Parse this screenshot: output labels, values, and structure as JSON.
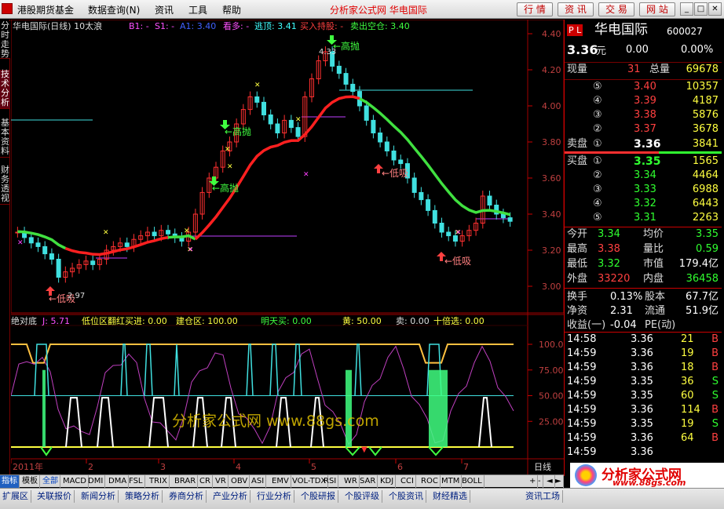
{
  "menu": {
    "items": [
      "港股期货基金",
      "数据查询(N)",
      "资讯",
      "工具",
      "帮助"
    ],
    "title": "分析家公式网  华电国际",
    "buttons": [
      "行 情",
      "资 讯",
      "交 易",
      "网 站"
    ]
  },
  "left_tabs": [
    "分时走势",
    "技术分析",
    "基本资料",
    "财务透视"
  ],
  "chart": {
    "header": "华电国际(日线) 10太浪",
    "header_items": [
      {
        "text": "B1: -",
        "color": "#ff50ff"
      },
      {
        "text": "S1: -",
        "color": "#ff50ff"
      },
      {
        "text": "A1: 3.40",
        "color": "#4060ff"
      },
      {
        "text": "看多: -",
        "color": "#ff50ff"
      },
      {
        "text": "逃顶: 3.41",
        "color": "#40ffff"
      },
      {
        "text": "买入持股: -",
        "color": "#ff4040"
      },
      {
        "text": "卖出空仓: 3.40",
        "color": "#40ff40"
      }
    ],
    "price_ticks": [
      "4.40",
      "4.20",
      "4.00",
      "3.80",
      "3.60",
      "3.40",
      "3.20",
      "3.00"
    ],
    "annotations": {
      "high_sell_1": "←高抛",
      "high_sell_2": "←高抛",
      "high_sell_3": "←高抛",
      "low_buy_1": "←低吸",
      "low_buy_2": "←低吸",
      "low_buy_3": "←低吸",
      "max_price": "4.33",
      "min_price": "2.97"
    },
    "indicator_header": [
      {
        "text": "绝对底",
        "color": "#ddd"
      },
      {
        "text": "J: 5.71",
        "color": "#ff50ff"
      },
      {
        "text": "低位区翻红买进: 0.00",
        "color": "#ffff40"
      },
      {
        "text": "建仓区: 100.00",
        "color": "#ffff40"
      },
      {
        "text": "明天买: 0.00",
        "color": "#40ff40"
      },
      {
        "text": "黄: 50.00",
        "color": "#ffff40"
      },
      {
        "text": "卖: 0.00",
        "color": "#ddd"
      },
      {
        "text": "十倍选: 0.00",
        "color": "#ffff40"
      }
    ],
    "ind_ticks": [
      "100.00",
      "75.00",
      "50.00",
      "25.00"
    ],
    "x_labels": [
      "2011年",
      "2",
      "3",
      "4",
      "5",
      "6",
      "7"
    ],
    "watermark": "分析家公式网 www.88gs.com",
    "period": "日线"
  },
  "quote": {
    "name": "华电国际",
    "code": "600027",
    "pl": "P L",
    "price": "3.36",
    "price_unit": "元",
    "change": "0.00",
    "change_pct": "0.00%",
    "volume_label": "现量",
    "volume": "31",
    "total_label": "总量",
    "total": "69678",
    "asks": [
      {
        "lv": "⑤",
        "p": "3.40",
        "v": "10357"
      },
      {
        "lv": "④",
        "p": "3.39",
        "v": "4187"
      },
      {
        "lv": "③",
        "p": "3.38",
        "v": "5876"
      },
      {
        "lv": "②",
        "p": "3.37",
        "v": "3678"
      }
    ],
    "ask1": {
      "label": "卖盘",
      "lv": "①",
      "p": "3.36",
      "v": "3841"
    },
    "bid1": {
      "label": "买盘",
      "lv": "①",
      "p": "3.35",
      "v": "1565"
    },
    "bids": [
      {
        "lv": "②",
        "p": "3.34",
        "v": "4464"
      },
      {
        "lv": "③",
        "p": "3.33",
        "v": "6988"
      },
      {
        "lv": "④",
        "p": "3.32",
        "v": "6443"
      },
      {
        "lv": "⑤",
        "p": "3.31",
        "v": "2263"
      }
    ],
    "stats": [
      [
        {
          "l": "今开",
          "v": "3.34",
          "c": "green"
        },
        {
          "l": "均价",
          "v": "3.35",
          "c": "green"
        }
      ],
      [
        {
          "l": "最高",
          "v": "3.38",
          "c": "red"
        },
        {
          "l": "量比",
          "v": "0.59",
          "c": "green"
        }
      ],
      [
        {
          "l": "最低",
          "v": "3.32",
          "c": "green"
        },
        {
          "l": "市值",
          "v": "179.4亿",
          "c": "white"
        }
      ],
      [
        {
          "l": "外盘",
          "v": "33220",
          "c": "red"
        },
        {
          "l": "内盘",
          "v": "36458",
          "c": "green"
        }
      ]
    ],
    "stats2": [
      [
        {
          "l": "换手",
          "v": "0.13%",
          "c": "white"
        },
        {
          "l": "股本",
          "v": "67.7亿",
          "c": "white"
        }
      ],
      [
        {
          "l": "净资",
          "v": "2.31",
          "c": "white"
        },
        {
          "l": "流通",
          "v": "51.9亿",
          "c": "white"
        }
      ],
      [
        {
          "l": "收益(一)",
          "v": "-0.04",
          "c": "white"
        },
        {
          "l": "PE(动)",
          "v": "",
          "c": "white"
        }
      ]
    ],
    "ticks": [
      {
        "t": "14:58",
        "p": "3.36",
        "v": "21",
        "d": "B"
      },
      {
        "t": "14:59",
        "p": "3.36",
        "v": "19",
        "d": "B"
      },
      {
        "t": "14:59",
        "p": "3.36",
        "v": "18",
        "d": "B"
      },
      {
        "t": "14:59",
        "p": "3.35",
        "v": "36",
        "d": "S"
      },
      {
        "t": "14:59",
        "p": "3.35",
        "v": "60",
        "d": "S"
      },
      {
        "t": "14:59",
        "p": "3.36",
        "v": "114",
        "d": "B"
      },
      {
        "t": "14:59",
        "p": "3.35",
        "v": "19",
        "d": "S"
      },
      {
        "t": "14:59",
        "p": "3.36",
        "v": "64",
        "d": "B"
      },
      {
        "t": "14:59",
        "p": "3.36",
        "v": "",
        "d": ""
      }
    ]
  },
  "bottom_tabs": [
    "指标",
    "模板",
    "全部",
    "MACD",
    "DMI",
    "DMA",
    "FSL",
    "TRIX",
    "BRAR",
    "CR",
    "VR",
    "OBV",
    "ASI",
    "EMV",
    "VOL-TDX",
    "RSI",
    "WR",
    "SAR",
    "KDJ",
    "CCI",
    "ROC",
    "MTM",
    "BOLL"
  ],
  "footer_tabs": [
    "扩展区",
    "关联报价",
    "新闻分析",
    "策略分析",
    "券商分析",
    "产业分析",
    "行业分析",
    "个股研报",
    "个股评级",
    "个股资讯",
    "财经精选"
  ],
  "footer_right": "资讯工场",
  "logo": {
    "title": "分析家公式网",
    "url": "www.88gs.com"
  }
}
